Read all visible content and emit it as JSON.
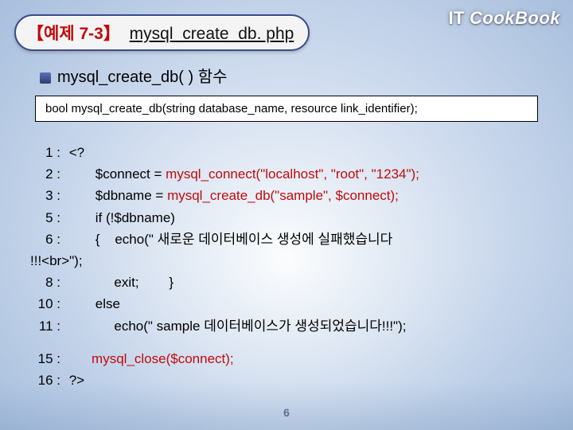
{
  "header": {
    "example_label": "【예제 7-3】",
    "filename": "mysql_create_db. php"
  },
  "brand": {
    "it": "IT",
    "cook": "CookBook"
  },
  "bullet": {
    "text": "mysql_create_db( ) 함수"
  },
  "signature": "bool mysql_create_db(string database_name, resource link_identifier);",
  "code": {
    "l1_no": " 1 :",
    "l1": " <?",
    "l2_no": " 2 :",
    "l2_a": "        $connect = ",
    "l2_red": "mysql_connect(\"localhost\", \"root\", \"1234\");",
    "l3_no": " 3 :",
    "l3_a": "        $dbname = ",
    "l3_red": "mysql_create_db(\"sample\", $connect);",
    "l5_no": " 5 :",
    "l5": "        if (!$dbname)",
    "l6_no": " 6 :",
    "l6": "        {    echo(\" 새로운 데이터베이스 생성에 실패했습니다",
    "l6b": "!!!<br>\");",
    "l8_no": " 8 :",
    "l8": "             exit;        }",
    "l10_no": "10 :",
    "l10": "        else",
    "l11_no": "11 :",
    "l11": "             echo(\" sample 데이터베이스가 생성되었습니다!!!\");",
    "l15_no": "15 :",
    "l15_red": "       mysql_close($connect);",
    "l16_no": "16 :",
    "l16": " ?>"
  },
  "page_number": "6"
}
